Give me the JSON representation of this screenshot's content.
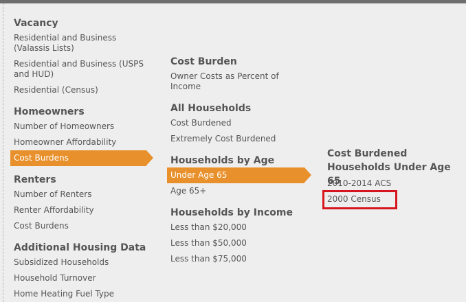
{
  "col1": {
    "vacancy_heading": "Vacancy",
    "vacancy_items": [
      "Residential and Business (Valassis Lists)",
      "Residential and Business (USPS and HUD)",
      "Residential (Census)"
    ],
    "homeowners_heading": "Homeowners",
    "homeowners_items": [
      "Number of Homeowners",
      "Homeowner Affordability",
      "Cost Burdens"
    ],
    "renters_heading": "Renters",
    "renters_items": [
      "Number of Renters",
      "Renter Affordability",
      "Cost Burdens"
    ],
    "additional_heading": "Additional Housing Data",
    "additional_items": [
      "Subsidized Households",
      "Household Turnover",
      "Home Heating Fuel Type"
    ]
  },
  "col2": {
    "cost_burden_heading": "Cost Burden",
    "cost_burden_items": [
      "Owner Costs as Percent of Income"
    ],
    "all_households_heading": "All Households",
    "all_households_items": [
      "Cost Burdened",
      "Extremely Cost Burdened"
    ],
    "by_age_heading": "Households by Age",
    "by_age_items": [
      "Under Age 65",
      "Age 65+"
    ],
    "by_income_heading": "Households by Income",
    "by_income_items": [
      "Less than $20,000",
      "Less than $50,000",
      "Less than $75,000"
    ]
  },
  "col3": {
    "heading": "Cost Burdened Households Under Age 65",
    "items": [
      "2010-2014 ACS",
      "2000 Census"
    ]
  },
  "colors": {
    "accent": "#e8912c",
    "highlight": "#d7151e",
    "text": "#555555",
    "background": "#eeeeee"
  }
}
